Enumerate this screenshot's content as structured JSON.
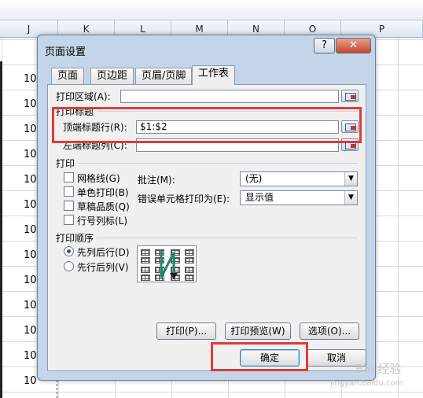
{
  "sheet": {
    "columns": [
      "J",
      "K",
      "L",
      "M",
      "N",
      "O",
      "P"
    ],
    "row_values": [
      "10",
      "10",
      "10",
      "10",
      "10",
      "10",
      "10",
      "10",
      "10",
      "10",
      "10",
      "10",
      "10"
    ]
  },
  "dialog": {
    "title": "页面设置",
    "help_label": "?",
    "close_label": "✕",
    "tabs": [
      "页面",
      "页边距",
      "页眉/页脚",
      "工作表"
    ],
    "print_area_label": "打印区域(A):",
    "print_area_value": "",
    "print_titles_header": "打印标题",
    "top_rows_label": "顶端标题行(R):",
    "top_rows_value": "$1:$2",
    "left_cols_label": "左端标题列(C):",
    "left_cols_value": "",
    "print_header": "打印",
    "checkboxes": [
      "网格线(G)",
      "单色打印(B)",
      "草稿品质(Q)",
      "行号列标(L)"
    ],
    "comments_label": "批注(M):",
    "comments_value": "(无)",
    "errors_label": "错误单元格打印为(E):",
    "errors_value": "显示值",
    "order_header": "打印顺序",
    "order_options": [
      "先列后行(D)",
      "先行后列(V)"
    ],
    "print_button": "打印(P)...",
    "preview_button": "打印预览(W)",
    "options_button": "选项(O)...",
    "ok_button": "确定",
    "cancel_button": "取消"
  },
  "watermark": {
    "line1": "Bai 经验",
    "line2": "jingyan.baidu.com"
  },
  "colors": {
    "highlight": "#e03a3a",
    "dialog_frame": "#c4d5ea"
  }
}
